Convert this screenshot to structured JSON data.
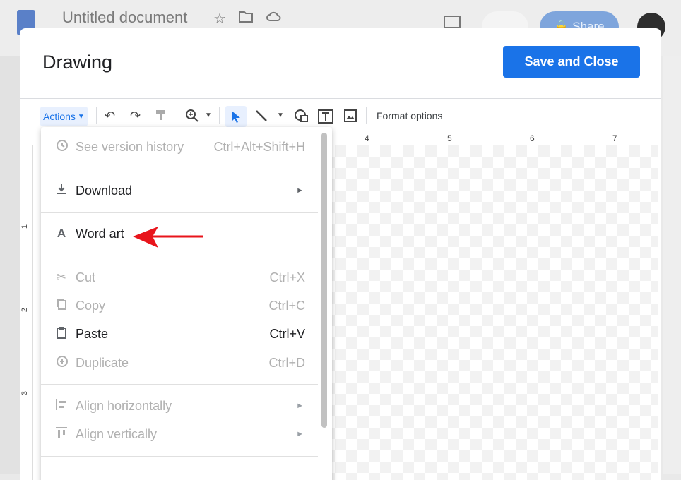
{
  "doc": {
    "title": "Untitled document",
    "share_label": "Share"
  },
  "dialog": {
    "title": "Drawing",
    "save_label": "Save and Close"
  },
  "toolbar": {
    "actions_label": "Actions",
    "format_options_label": "Format options"
  },
  "ruler": {
    "top_numbers": [
      "4",
      "5",
      "6",
      "7"
    ],
    "left_numbers": [
      "1",
      "2",
      "3"
    ]
  },
  "menu": {
    "version_history": {
      "label": "See version history",
      "shortcut": "Ctrl+Alt+Shift+H"
    },
    "download": {
      "label": "Download"
    },
    "word_art": {
      "label": "Word art"
    },
    "cut": {
      "label": "Cut",
      "shortcut": "Ctrl+X"
    },
    "copy": {
      "label": "Copy",
      "shortcut": "Ctrl+C"
    },
    "paste": {
      "label": "Paste",
      "shortcut": "Ctrl+V"
    },
    "duplicate": {
      "label": "Duplicate",
      "shortcut": "Ctrl+D"
    },
    "align_h": {
      "label": "Align horizontally"
    },
    "align_v": {
      "label": "Align vertically"
    }
  },
  "colors": {
    "accent": "#1a73e8",
    "annotation_arrow": "#e8141b"
  }
}
